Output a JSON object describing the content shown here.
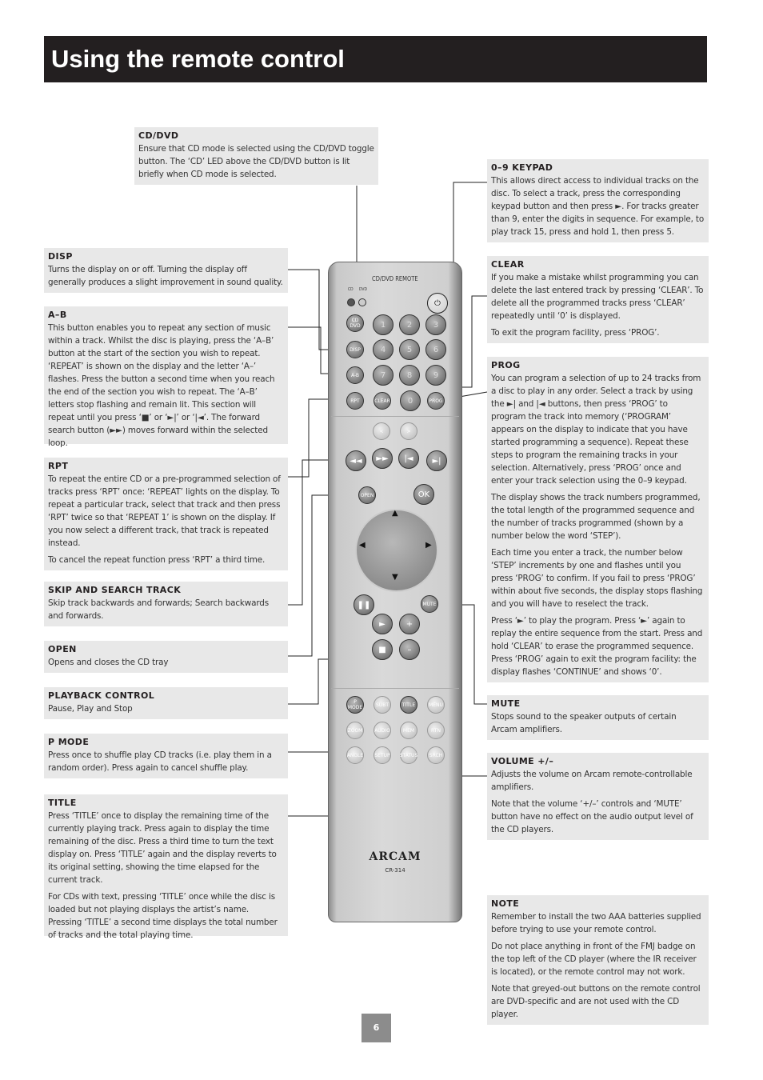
{
  "title": "Using the remote control",
  "page_number": "6",
  "sections": {
    "cddvd": {
      "heading": "CD/DVD",
      "p": [
        "Ensure that CD mode is selected using the CD/DVD toggle button. The ‘CD’ LED above the CD/DVD button is lit briefly when CD mode is selected."
      ]
    },
    "disp": {
      "heading": "DISP",
      "p": [
        "Turns the display on or off. Turning the display off generally produces a slight improvement in sound quality."
      ]
    },
    "ab": {
      "heading": "A–B",
      "p": [
        "This button enables you to repeat any section of music within a track. Whilst the disc is playing, press the ‘A–B’ button at the start of the section you wish to repeat. ‘REPEAT’ is shown on the display and the letter ‘A–’ flashes. Press the button a second time when you reach the end of the section you wish to repeat. The ‘A–B’ letters stop flashing and remain lit. This section will repeat until you press ‘■’ or ‘►|’ or ‘|◄’. The forward search button (►►) moves forward within the selected loop."
      ]
    },
    "rpt": {
      "heading": "RPT",
      "p": [
        "To repeat the entire CD or a pre-programmed selection of tracks press ‘RPT’ once: ‘REPEAT’ lights on the display. To repeat a particular track, select that track and then press ‘RPT’ twice so that ‘REPEAT 1’ is shown on the display. If you now select a different track, that track is repeated instead.",
        "To cancel the repeat function press ‘RPT’ a third time."
      ]
    },
    "skip": {
      "heading": "SKIP AND SEARCH TRACK",
      "p": [
        "Skip track backwards and forwards; Search backwards and forwards."
      ]
    },
    "open": {
      "heading": "OPEN",
      "p": [
        "Opens and closes the CD tray"
      ]
    },
    "playback": {
      "heading": "PLAYBACK CONTROL",
      "p": [
        "Pause, Play and Stop"
      ]
    },
    "pmode": {
      "heading": "P MODE",
      "p": [
        "Press once to shuffle play CD tracks (i.e. play them in a random order). Press again to cancel shuffle play."
      ]
    },
    "title": {
      "heading": "TITLE",
      "p": [
        "Press ‘TITLE’ once to display the remaining time of the currently playing track. Press again to display the time remaining of the disc. Press a third time to turn the text display on. Press ‘TITLE’ again and the display reverts to its original setting, showing the time elapsed for the current track.",
        "For CDs with text, pressing ‘TITLE’ once while the disc is loaded but not playing displays the artist’s name. Pressing ‘TITLE’ a second time displays the total number of tracks and the total playing time."
      ]
    },
    "keypad": {
      "heading": "0–9 KEYPAD",
      "p": [
        "This allows direct access to individual tracks on the disc. To select a track, press the corresponding keypad button and then press ►. For tracks greater than 9, enter the digits in sequence. For example, to play track 15, press and hold 1, then press 5."
      ]
    },
    "clear": {
      "heading": "CLEAR",
      "p": [
        "If you make a mistake whilst programming you can delete the last entered track by pressing ‘CLEAR’. To delete all the programmed tracks press ‘CLEAR’ repeatedly until ‘0’ is displayed.",
        "To exit the program facility, press ‘PROG’."
      ]
    },
    "prog": {
      "heading": "PROG",
      "p": [
        "You can program a selection of up to 24 tracks from a disc to play in any order. Select a track by using the ►| and |◄ buttons, then press ‘PROG’ to program the track into memory (‘PROGRAM’ appears on the display to indicate that you have started programming a sequence). Repeat these steps to program the remaining tracks in your selection. Alternatively, press ‘PROG’ once and enter your track selection using the 0–9 keypad.",
        "The display shows the track numbers programmed, the total length of the programmed sequence and the number of tracks programmed (shown by a number below the word ‘STEP’).",
        "Each time you enter a track, the number below ‘STEP’ increments by one and flashes until you press ‘PROG’ to confirm. If you fail to press ‘PROG’ within about five seconds, the display stops flashing and you will have to reselect the track.",
        "Press ‘►’ to play the program. Press ‘►’ again to replay the entire sequence from the start. Press and hold ‘CLEAR’ to erase the programmed sequence. Press ‘PROG’ again to exit the program facility: the display flashes ‘CONTINUE’ and shows ‘0’."
      ]
    },
    "mute": {
      "heading": "MUTE",
      "p": [
        "Stops sound to the speaker outputs of certain Arcam amplifiers."
      ]
    },
    "volume": {
      "heading": "VOLUME +/–",
      "p": [
        "Adjusts the volume on Arcam remote-controllable amplifiers.",
        "Note that the volume ‘+/–’ controls and ‘MUTE’ button have no effect on the audio output level of the CD players."
      ]
    },
    "note": {
      "heading": "NOTE",
      "p": [
        "Remember to install the two AAA batteries supplied before trying to use your remote control.",
        "Do not place anything in front of the FMJ badge on the top left of the CD player (where the IR receiver is located), or the remote control may not work.",
        "Note that greyed-out buttons on the remote control are DVD-specific and are not used with the CD player."
      ]
    }
  },
  "remote": {
    "header": "CD/DVD  REMOTE",
    "led_cd": "CD",
    "led_dvd": "DVD",
    "brand": "ARCAM",
    "model": "CR-314",
    "buttons": {
      "power": "⏻",
      "cddvd": "CD DVD",
      "disp": "DISP",
      "ab": "A-B",
      "rpt": "RPT",
      "clear": "CLEAR",
      "prog": "PROG",
      "n0": "0",
      "n1": "1",
      "n2": "2",
      "n3": "3",
      "n4": "4",
      "n5": "5",
      "n6": "6",
      "n7": "7",
      "n8": "8",
      "n9": "9",
      "left": "<",
      "right": ">",
      "rew": "◄◄",
      "ffw": "►►",
      "prev": "|◄",
      "next": "►|",
      "open": "OPEN",
      "ok": "OK",
      "pause": "❚❚",
      "mute": "MUTE",
      "play": "►",
      "stop": "■",
      "volup": "+",
      "voldown": "–",
      "pmode": "P MODE",
      "subt": "SUBT",
      "title": "TITLE",
      "menu": "MENU",
      "zoom": "ZOOM",
      "audio": "AUDIO",
      "mem": "MEM",
      "rtn": "RTN",
      "angle": "ANGLE",
      "setup": "SETUP",
      "status": "STATUS",
      "srch": "SRCH"
    }
  }
}
